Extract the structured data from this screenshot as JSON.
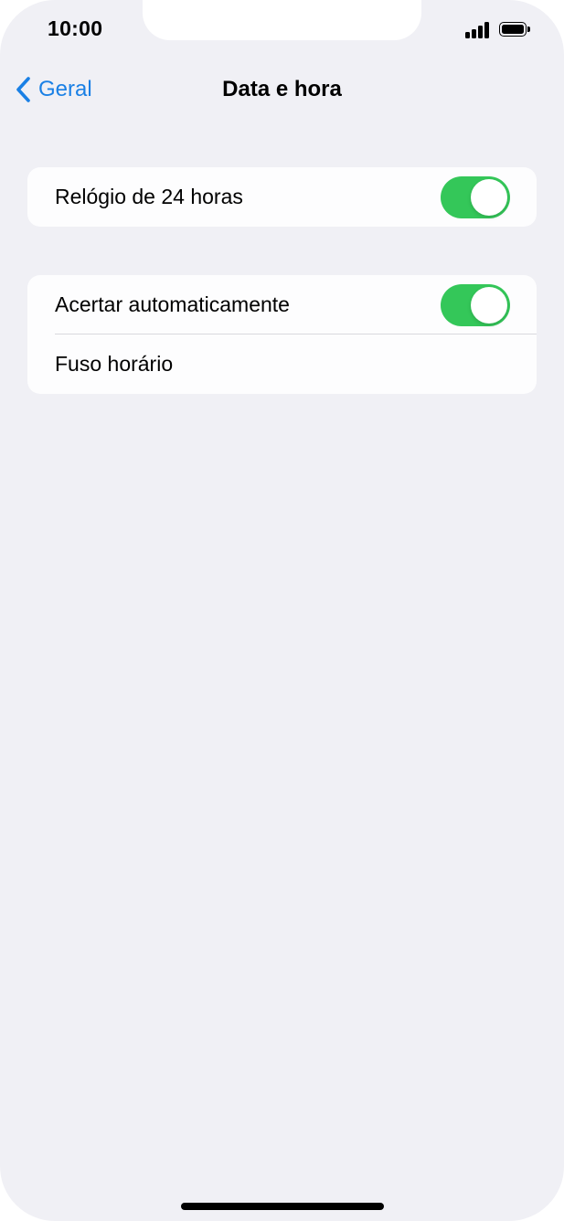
{
  "status_bar": {
    "time": "10:00",
    "signal_icon": "cellular-signal-icon",
    "battery_icon": "battery-full-icon"
  },
  "nav": {
    "back_label": "Geral",
    "back_icon": "chevron-left-icon",
    "title": "Data e hora"
  },
  "groups": [
    {
      "rows": [
        {
          "label": "Relógio de 24 horas",
          "toggle": true
        }
      ]
    },
    {
      "rows": [
        {
          "label": "Acertar automaticamente",
          "toggle": true
        },
        {
          "label": "Fuso horário"
        }
      ]
    }
  ],
  "colors": {
    "background": "#f0f0f5",
    "accent": "#1a80e5",
    "toggle_on": "#34c759"
  }
}
